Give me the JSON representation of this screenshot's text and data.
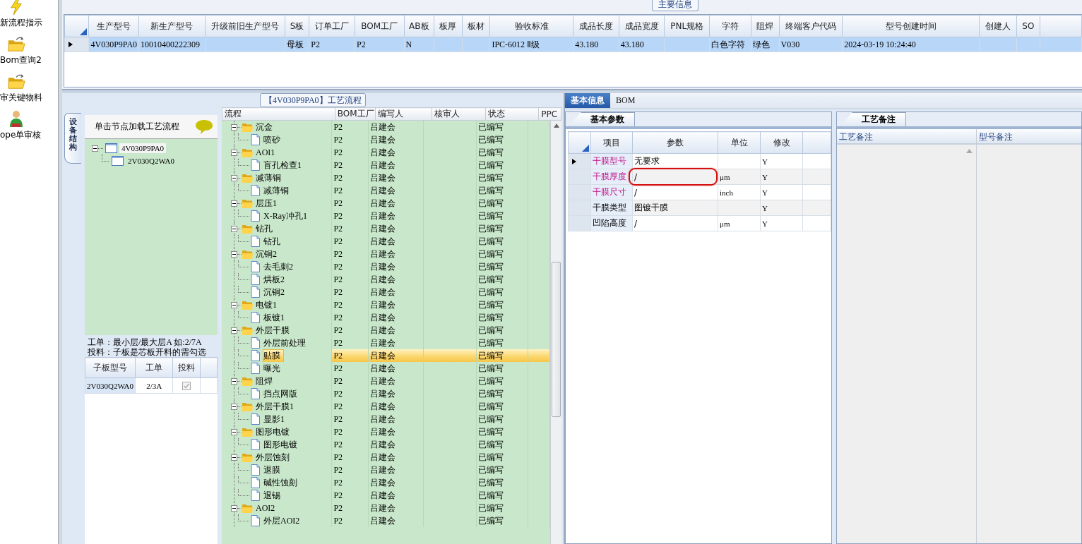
{
  "sidebar": {
    "items": [
      {
        "label": "新流程指示",
        "kind": "bolt"
      },
      {
        "label": "Bom查询2",
        "kind": "folder"
      },
      {
        "label": "审关键物料",
        "kind": "folder"
      },
      {
        "label": "ope单审核",
        "kind": "person"
      }
    ]
  },
  "main_info": {
    "title": "主要信息",
    "columns": [
      "生产型号",
      "新生产型号",
      "升级前旧生产型号",
      "S板",
      "订单工厂",
      "BOM工厂",
      "AB板",
      "板厚",
      "板材",
      "验收标准",
      "成品长度",
      "成品宽度",
      "PNL规格",
      "字符",
      "阻焊",
      "终端客户代码",
      "型号创建时间",
      "创建人",
      "SO"
    ],
    "rows": [
      {
        "selected": true,
        "cells": [
          "4V030P9PA0",
          "10010400222309",
          null,
          "母板",
          "P2",
          "P2",
          "N",
          null,
          null,
          "IPC-6012 Ⅱ级",
          "43.180",
          "43.180",
          null,
          "白色字符",
          "绿色",
          "V030",
          "2024-03-19 10:24:40",
          null,
          null
        ]
      }
    ]
  },
  "flow_panel": {
    "title": "【4V030P9PA0】工艺流程",
    "side_tab": "设备结构",
    "tree_header": "单击节点加载工艺流程",
    "tree": [
      {
        "label": "4V030P9PA0",
        "selected": true,
        "expanded": true,
        "children": [
          {
            "label": "2V030Q2WA0",
            "selected": false
          }
        ]
      }
    ],
    "note_lines": [
      "工单：最小层/最大层A 如:2/7A",
      "投料：子板是芯板开料的需勾选"
    ],
    "sub_table": {
      "columns": [
        "子板型号",
        "工单",
        "投料"
      ],
      "rows": [
        {
          "model": "2V030Q2WA0",
          "order": "2/3A",
          "feed": true,
          "disabled": true,
          "selected": true
        }
      ]
    },
    "process": {
      "columns": [
        "流程",
        "BOM工厂",
        "编写人",
        "核审人",
        "状态",
        "PPC"
      ],
      "steps": [
        {
          "name": "沉金",
          "factory": "P2",
          "writer": "吕建会",
          "status": "已编写",
          "selected": false,
          "expanded": true,
          "children": [
            {
              "name": "喷砂",
              "factory": "P2",
              "writer": "吕建会",
              "status": "已编写",
              "selected": false
            }
          ]
        },
        {
          "name": "AOI1",
          "factory": "P2",
          "writer": "吕建会",
          "status": "已编写",
          "selected": false,
          "expanded": true,
          "children": [
            {
              "name": "盲孔检查1",
              "factory": "P2",
              "writer": "吕建会",
              "status": "已编写",
              "selected": false
            }
          ]
        },
        {
          "name": "减薄铜",
          "factory": "P2",
          "writer": "吕建会",
          "status": "已编写",
          "selected": false,
          "expanded": true,
          "children": [
            {
              "name": "减薄铜",
              "factory": "P2",
              "writer": "吕建会",
              "status": "已编写",
              "selected": false
            }
          ]
        },
        {
          "name": "层压1",
          "factory": "P2",
          "writer": "吕建会",
          "status": "已编写",
          "selected": false,
          "expanded": true,
          "children": [
            {
              "name": "X-Ray冲孔1",
              "factory": "P2",
              "writer": "吕建会",
              "status": "已编写",
              "selected": false
            }
          ]
        },
        {
          "name": "钻孔",
          "factory": "P2",
          "writer": "吕建会",
          "status": "已编写",
          "selected": false,
          "expanded": true,
          "children": [
            {
              "name": "钻孔",
              "factory": "P2",
              "writer": "吕建会",
              "status": "已编写",
              "selected": false
            }
          ]
        },
        {
          "name": "沉铜2",
          "factory": "P2",
          "writer": "吕建会",
          "status": "已编写",
          "selected": false,
          "expanded": true,
          "children": [
            {
              "name": "去毛刺2",
              "factory": "P2",
              "writer": "吕建会",
              "status": "已编写",
              "selected": false
            },
            {
              "name": "烘板2",
              "factory": "P2",
              "writer": "吕建会",
              "status": "已编写",
              "selected": false
            },
            {
              "name": "沉铜2",
              "factory": "P2",
              "writer": "吕建会",
              "status": "已编写",
              "selected": false
            }
          ]
        },
        {
          "name": "电镀1",
          "factory": "P2",
          "writer": "吕建会",
          "status": "已编写",
          "selected": false,
          "expanded": true,
          "children": [
            {
              "name": "板镀1",
              "factory": "P2",
              "writer": "吕建会",
              "status": "已编写",
              "selected": false
            }
          ]
        },
        {
          "name": "外层干膜",
          "factory": "P2",
          "writer": "吕建会",
          "status": "已编写",
          "selected": false,
          "expanded": true,
          "children": [
            {
              "name": "外层前处理",
              "factory": "P2",
              "writer": "吕建会",
              "status": "已编写",
              "selected": false
            },
            {
              "name": "贴膜",
              "factory": "P2",
              "writer": "吕建会",
              "status": "已编写",
              "selected": true
            },
            {
              "name": "曝光",
              "factory": "P2",
              "writer": "吕建会",
              "status": "已编写",
              "selected": false
            }
          ]
        },
        {
          "name": "阻焊",
          "factory": "P2",
          "writer": "吕建会",
          "status": "已编写",
          "selected": false,
          "expanded": true,
          "children": [
            {
              "name": "挡点网版",
              "factory": "P2",
              "writer": "吕建会",
              "status": "已编写",
              "selected": false
            }
          ]
        },
        {
          "name": "外层干膜1",
          "factory": "P2",
          "writer": "吕建会",
          "status": "已编写",
          "selected": false,
          "expanded": true,
          "children": [
            {
              "name": "显影1",
              "factory": "P2",
              "writer": "吕建会",
              "status": "已编写",
              "selected": false
            }
          ]
        },
        {
          "name": "图形电镀",
          "factory": "P2",
          "writer": "吕建会",
          "status": "已编写",
          "selected": false,
          "expanded": true,
          "children": [
            {
              "name": "图形电镀",
              "factory": "P2",
              "writer": "吕建会",
              "status": "已编写",
              "selected": false
            }
          ]
        },
        {
          "name": "外层蚀刻",
          "factory": "P2",
          "writer": "吕建会",
          "status": "已编写",
          "selected": false,
          "expanded": true,
          "children": [
            {
              "name": "退膜",
              "factory": "P2",
              "writer": "吕建会",
              "status": "已编写",
              "selected": false
            },
            {
              "name": "碱性蚀刻",
              "factory": "P2",
              "writer": "吕建会",
              "status": "已编写",
              "selected": false
            },
            {
              "name": "退锡",
              "factory": "P2",
              "writer": "吕建会",
              "status": "已编写",
              "selected": false
            }
          ]
        },
        {
          "name": "AOI2",
          "factory": "P2",
          "writer": "吕建会",
          "status": "已编写",
          "selected": false,
          "expanded": true,
          "children": [
            {
              "name": "外层AOI2",
              "factory": "P2",
              "writer": "吕建会",
              "status": "已编写",
              "selected": false
            }
          ]
        }
      ]
    }
  },
  "detail": {
    "tabs": [
      {
        "label": "基本信息",
        "selected": true
      },
      {
        "label": "BOM",
        "selected": false
      }
    ],
    "params": {
      "tab": "基本参数",
      "columns": [
        "项目",
        "参数",
        "单位",
        "修改"
      ],
      "rows": [
        {
          "item": "干膜型号",
          "value": "无要求",
          "modify": "Y",
          "required": true,
          "selected": true,
          "circled": false
        },
        {
          "item": "干膜厚度",
          "value": "/",
          "unit": "μm",
          "modify": "Y",
          "required": true,
          "selected": false,
          "circled": true
        },
        {
          "item": "干膜尺寸",
          "value": "/",
          "unit": "inch",
          "modify": "Y",
          "required": true,
          "selected": false,
          "circled": false
        },
        {
          "item": "干膜类型",
          "value": "图镀干膜",
          "modify": "Y",
          "required": false,
          "selected": false,
          "circled": false
        },
        {
          "item": "凹陷高度",
          "value": "/",
          "unit": "μm",
          "modify": "Y",
          "required": false,
          "selected": false,
          "circled": false
        }
      ]
    },
    "remarks": {
      "tab": "工艺备注",
      "columns": [
        "工艺备注",
        "型号备注"
      ]
    }
  }
}
